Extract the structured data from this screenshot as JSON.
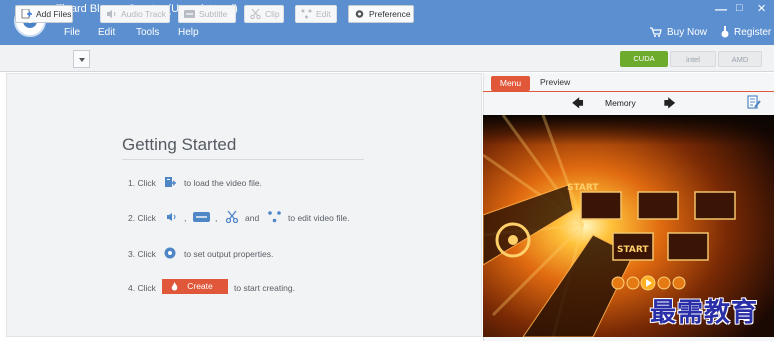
{
  "window": {
    "title": "Tipard Blu-ray Creator (Unregistered)",
    "controls": {
      "minimize": "—",
      "maximize": "□",
      "close": "✕"
    }
  },
  "menu": [
    "File",
    "Edit",
    "Tools",
    "Help"
  ],
  "top_links": {
    "buy_now": "Buy Now",
    "register": "Register"
  },
  "toolbar": {
    "add_files": "Add Files",
    "audio_track": "Audio Track",
    "subtitle": "Subtitle",
    "clip": "Clip",
    "edit": "Edit",
    "preference": "Preference"
  },
  "gpu": {
    "cuda": "CUDA",
    "intel": "intel",
    "amd": "AMD"
  },
  "getting_started": {
    "title": "Getting Started",
    "step1": {
      "prefix": "1. Click",
      "suffix": "to load the video file."
    },
    "step2": {
      "prefix": "2. Click",
      "comma1": ",",
      "comma2": ",",
      "and": "and",
      "suffix": "to edit video file."
    },
    "step3": {
      "prefix": "3. Click",
      "suffix": "to set output properties."
    },
    "step4": {
      "prefix": "4. Click",
      "button": "Create",
      "suffix": "to start creating."
    }
  },
  "panel": {
    "tabs": [
      "Menu",
      "Preview"
    ],
    "template_name": "Memory",
    "menu_preview_buttons": [
      "START",
      "START"
    ]
  },
  "watermark": "最需教育",
  "colors": {
    "titlebar": "#5b8fd0",
    "accent": "#e0573a",
    "cuda": "#6cab2c"
  }
}
